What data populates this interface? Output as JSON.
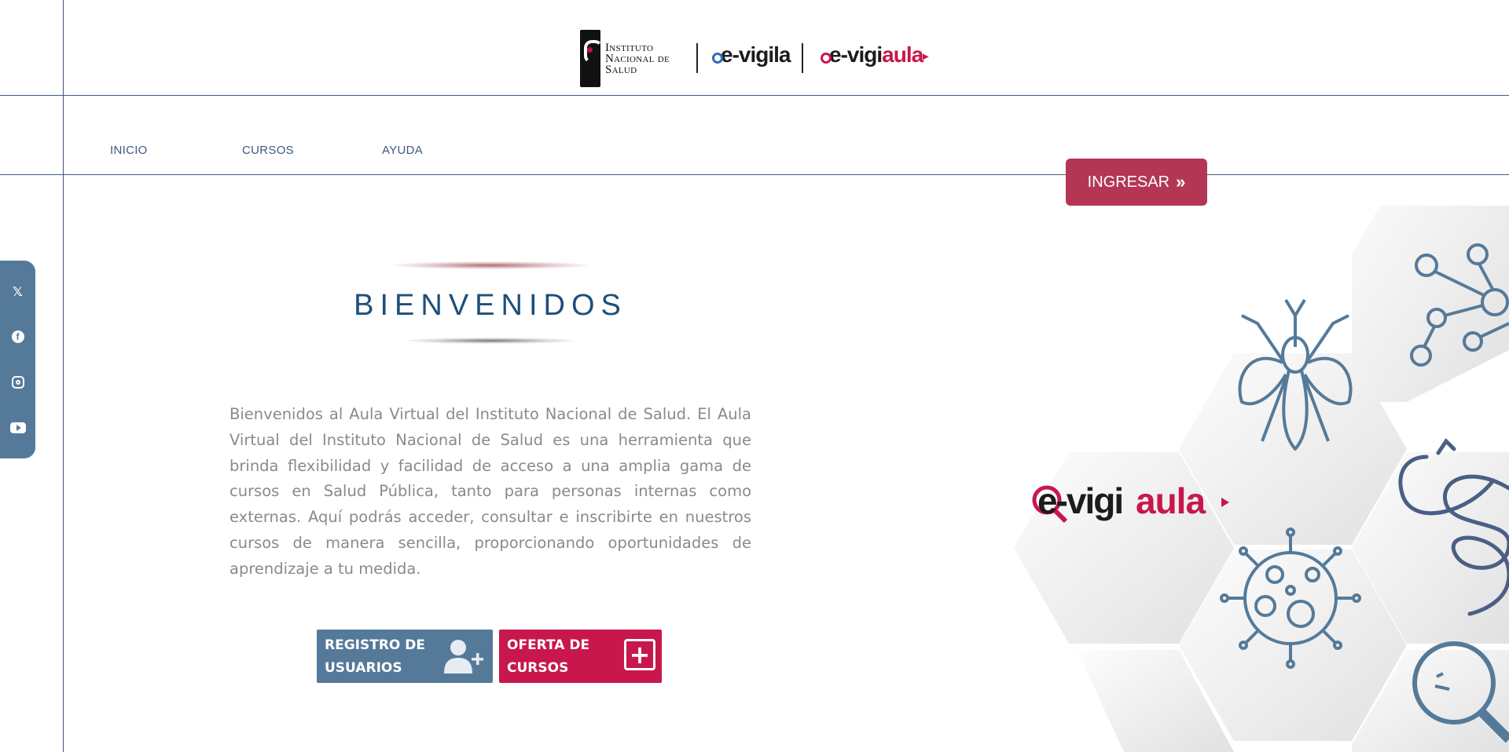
{
  "header": {
    "institute_line1": "Instituto",
    "institute_line2": "Nacional de",
    "institute_line3": "Salud",
    "evigila_prefix": "e-",
    "evigila_name": "vigila",
    "evigila_aula_prefix": "e-vigi",
    "evigila_aula_suffix": "aula"
  },
  "nav": {
    "items": [
      {
        "label": "INICIO"
      },
      {
        "label": "CURSOS"
      },
      {
        "label": "AYUDA"
      }
    ],
    "login_label": "INGRESAR",
    "login_icon": "double-chevron-right"
  },
  "social": {
    "items": [
      {
        "icon": "x-twitter-icon",
        "glyph": "𝕏"
      },
      {
        "icon": "facebook-icon",
        "glyph": "f"
      },
      {
        "icon": "instagram-icon"
      },
      {
        "icon": "youtube-icon"
      }
    ]
  },
  "welcome": {
    "title": "BIENVENIDOS",
    "body": "Bienvenidos al Aula Virtual del Instituto Nacional de Salud. El Aula Virtual del Instituto Nacional de Salud es una herramienta que brinda flexibilidad y facilidad de acceso a una amplia gama de cursos en Salud Pública, tanto para personas internas como externas. Aquí podrás acceder, consultar e inscribirte en nuestros cursos de manera sencilla, proporcionando oportunidades de aprendizaje a tu medida."
  },
  "actions": {
    "registro_line1": "REGISTRO DE",
    "registro_line2": "USUARIOS",
    "oferta_line1": "OFERTA DE",
    "oferta_line2": "CURSOS"
  },
  "colors": {
    "brand_blue": "#3f5a7e",
    "title_blue": "#1d4f7a",
    "accent_red": "#b33755",
    "accent_magenta": "#c8174c",
    "social_bg": "#557a99"
  },
  "hexart": {
    "logo_prefix": "e-vigi",
    "logo_suffix": "aula"
  }
}
